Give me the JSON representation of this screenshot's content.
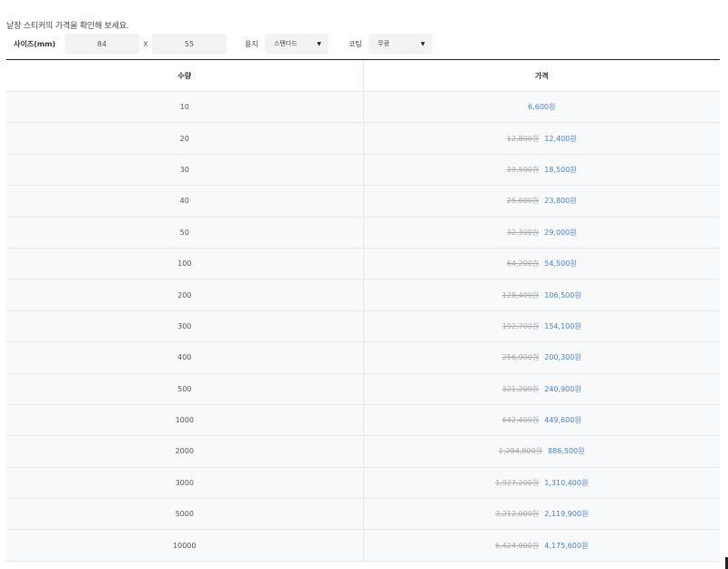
{
  "intro_text": "낱장 스티커의 가격을 확인해 보세요.",
  "size": {
    "label": "사이즈(mm)",
    "width": "84",
    "height": "55",
    "separator": "X"
  },
  "paper": {
    "label": "용지",
    "selected": "스탠다드"
  },
  "coating": {
    "label": "코팅",
    "selected": "무광"
  },
  "table": {
    "headers": {
      "qty": "수량",
      "price": "가격"
    },
    "rows": [
      {
        "qty": "10",
        "original": "",
        "price": "6,600원"
      },
      {
        "qty": "20",
        "original": "12,800원",
        "price": "12,400원"
      },
      {
        "qty": "30",
        "original": "19,500원",
        "price": "18,500원"
      },
      {
        "qty": "40",
        "original": "25,600원",
        "price": "23,800원"
      },
      {
        "qty": "50",
        "original": "32,300원",
        "price": "29,000원"
      },
      {
        "qty": "100",
        "original": "64,200원",
        "price": "54,500원"
      },
      {
        "qty": "200",
        "original": "128,400원",
        "price": "106,500원"
      },
      {
        "qty": "300",
        "original": "192,700원",
        "price": "154,100원"
      },
      {
        "qty": "400",
        "original": "256,900원",
        "price": "200,300원"
      },
      {
        "qty": "500",
        "original": "321,200원",
        "price": "240,900원"
      },
      {
        "qty": "1000",
        "original": "642,400원",
        "price": "449,600원"
      },
      {
        "qty": "2000",
        "original": "1,284,800원",
        "price": "886,500원"
      },
      {
        "qty": "3000",
        "original": "1,927,200원",
        "price": "1,310,400원"
      },
      {
        "qty": "5000",
        "original": "3,212,000원",
        "price": "2,119,900원"
      },
      {
        "qty": "10000",
        "original": "6,424,000원",
        "price": "4,175,600원"
      }
    ]
  },
  "colors": {
    "sale_price": "#4a7fd0",
    "original_price": "#aaaaaa",
    "row_bg": "#f8f9fa"
  }
}
